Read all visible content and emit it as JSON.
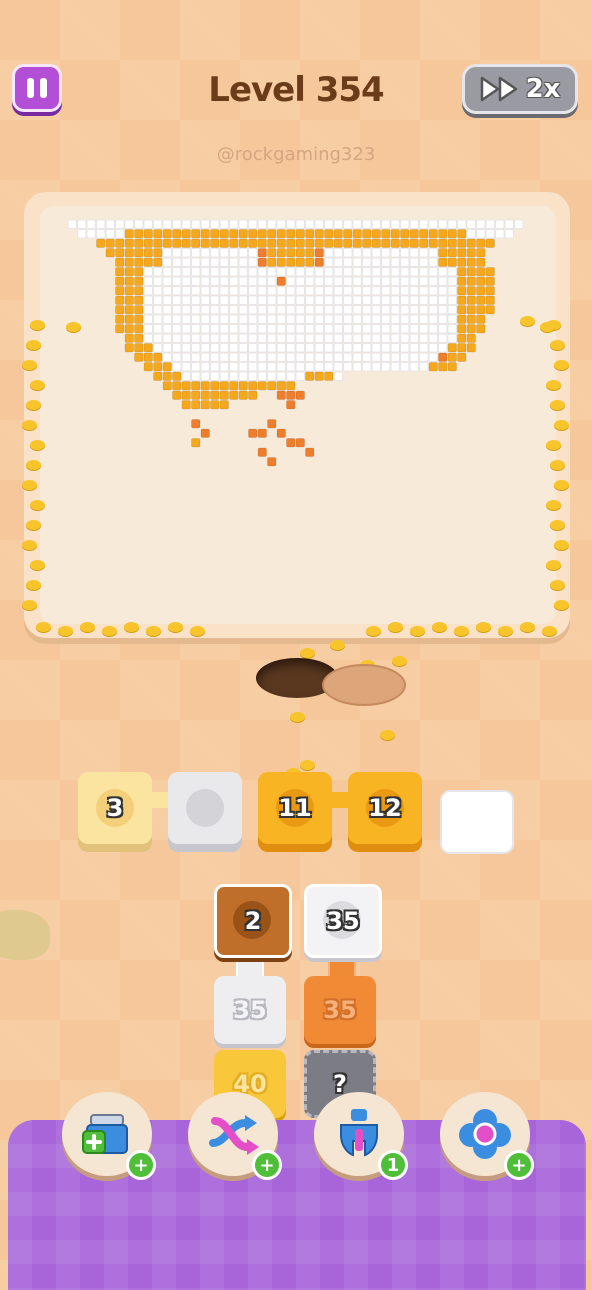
{
  "header": {
    "level_label": "Level 354",
    "speed_label": "2x",
    "watermark": "@rockgaming323"
  },
  "colors": {
    "white_pixel": "#ffffff",
    "orange_pixel": "#f6a81c",
    "dark_orange_pixel": "#ee7e2c",
    "ant": "#f7c52b",
    "tray": "#a765d9"
  },
  "conveyor_slots": [
    {
      "value": "3",
      "color": "#fbe3a0"
    },
    {
      "value": "",
      "color": "#e9e9ec"
    },
    {
      "value": "11",
      "color": "#f8b423"
    },
    {
      "value": "12",
      "color": "#f8b423"
    },
    {
      "value": "",
      "color": "#ffffff"
    }
  ],
  "stacks": [
    {
      "tiles": [
        {
          "value": "2",
          "color": "#c06f2b"
        },
        {
          "value": "35",
          "color": "#eeeef0"
        },
        {
          "value": "40",
          "color": "#f8c83a"
        }
      ]
    },
    {
      "tiles": [
        {
          "value": "35",
          "color": "#f3f3f5"
        },
        {
          "value": "35",
          "color": "#f08a35"
        },
        {
          "value": "?",
          "color": "#7c7c84"
        }
      ]
    }
  ],
  "boosters": [
    {
      "icon": "box-add-icon",
      "badge": "+"
    },
    {
      "icon": "shuffle-arrows-icon",
      "badge": "+"
    },
    {
      "icon": "magnet-claw-icon",
      "badge": "1"
    },
    {
      "icon": "flower-bomb-icon",
      "badge": "+"
    }
  ]
}
